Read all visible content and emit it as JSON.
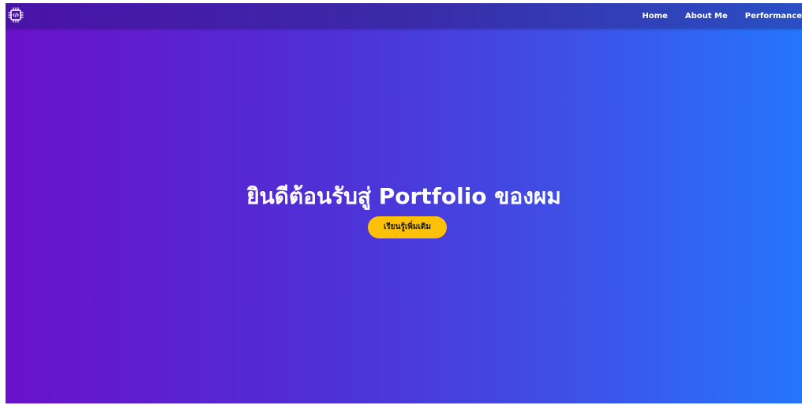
{
  "navbar": {
    "logo_icon": "circuit-chip-code-icon",
    "links": [
      {
        "label": "Home"
      },
      {
        "label": "About Me"
      },
      {
        "label": "Performance"
      }
    ]
  },
  "hero": {
    "title": "ยินดีต้อนรับสู่ Portfolio ของผม",
    "button_label": "เรียนรู้เพิ่มเติม"
  },
  "colors": {
    "gradient_start": "#6a11cb",
    "gradient_end": "#2575fc",
    "button_bg": "#ffc107",
    "text": "#ffffff"
  }
}
